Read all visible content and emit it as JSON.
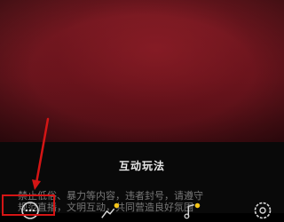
{
  "panel": {
    "title": "互动玩法",
    "notice_lines": [
      "禁止低俗、暴力等内容，违者封号，请遵守",
      "规范直播，文明互动，共同营造良好氛围"
    ]
  },
  "toolbar": {
    "items": [
      {
        "name": "more",
        "icon": "more-dots-icon"
      },
      {
        "name": "gift",
        "icon": "gift-icon",
        "badge": true
      },
      {
        "name": "music",
        "icon": "music-note-icon",
        "badge": true
      },
      {
        "name": "settings",
        "icon": "gear-icon"
      }
    ]
  },
  "colors": {
    "highlight": "#d41515",
    "badge": "#f5c518",
    "video_bg": "#6a151d",
    "panel_bg": "#090909"
  }
}
